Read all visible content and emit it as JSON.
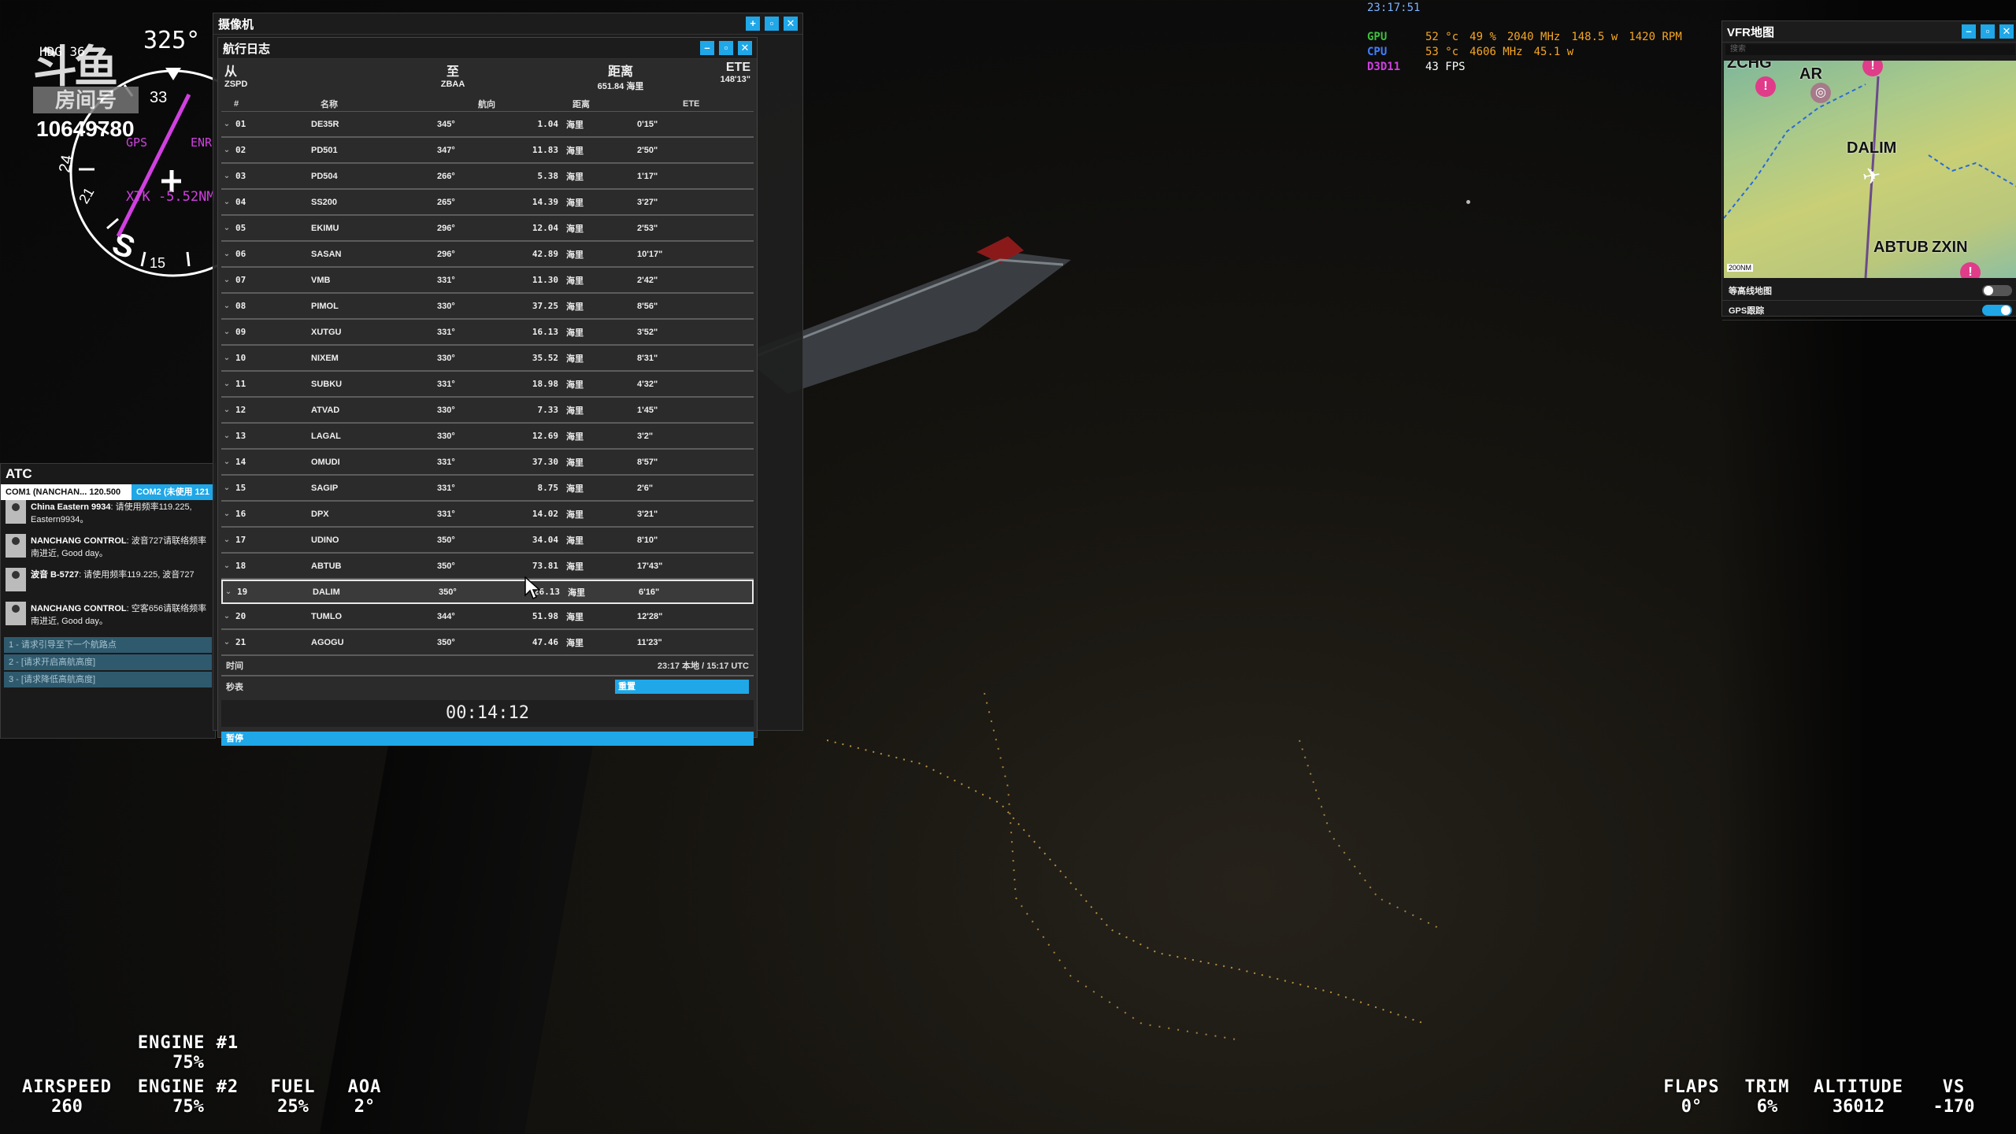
{
  "hud_top": {
    "time": "23:17:51",
    "perf": [
      {
        "key": "GPU",
        "vals": [
          "52 °c",
          "49 %",
          "2040 MHz",
          "148.5 w",
          "1420 RPM"
        ]
      },
      {
        "key": "CPU",
        "vals": [
          "53 °c",
          "4606 MHz",
          "45.1 w"
        ]
      },
      {
        "key": "D3D11",
        "vals": [
          "43 FPS"
        ]
      }
    ]
  },
  "compass": {
    "hdg_label": "HDG",
    "hdg_small": "36",
    "heading": "325°",
    "gps": "GPS",
    "enr": "ENR",
    "xtk": "XTK -5.52NM",
    "logo_main": "斗鱼",
    "logo_room": "房间号",
    "room_number": "10649780"
  },
  "camera_panel": {
    "title": "摄像机"
  },
  "logbook": {
    "title": "航行日志",
    "from_label": "从",
    "from_code": "ZSPD",
    "to_label": "至",
    "to_code": "ZBAA",
    "dist_label": "距离",
    "dist_value": "651.84 海里",
    "ete_label": "ETE",
    "ete_value": "148'13\"",
    "columns": [
      "#",
      "名称",
      "航向",
      "距离",
      "ETE"
    ],
    "rows": [
      {
        "n": "01",
        "name": "DE35R",
        "hdg": "345°",
        "dist": "1.04",
        "unit": "海里",
        "ete": "0'15\""
      },
      {
        "n": "02",
        "name": "PD501",
        "hdg": "347°",
        "dist": "11.83",
        "unit": "海里",
        "ete": "2'50\""
      },
      {
        "n": "03",
        "name": "PD504",
        "hdg": "266°",
        "dist": "5.38",
        "unit": "海里",
        "ete": "1'17\""
      },
      {
        "n": "04",
        "name": "SS200",
        "hdg": "265°",
        "dist": "14.39",
        "unit": "海里",
        "ete": "3'27\""
      },
      {
        "n": "05",
        "name": "EKIMU",
        "hdg": "296°",
        "dist": "12.04",
        "unit": "海里",
        "ete": "2'53\""
      },
      {
        "n": "06",
        "name": "SASAN",
        "hdg": "296°",
        "dist": "42.89",
        "unit": "海里",
        "ete": "10'17\""
      },
      {
        "n": "07",
        "name": "VMB",
        "hdg": "331°",
        "dist": "11.30",
        "unit": "海里",
        "ete": "2'42\""
      },
      {
        "n": "08",
        "name": "PIMOL",
        "hdg": "330°",
        "dist": "37.25",
        "unit": "海里",
        "ete": "8'56\""
      },
      {
        "n": "09",
        "name": "XUTGU",
        "hdg": "331°",
        "dist": "16.13",
        "unit": "海里",
        "ete": "3'52\""
      },
      {
        "n": "10",
        "name": "NIXEM",
        "hdg": "330°",
        "dist": "35.52",
        "unit": "海里",
        "ete": "8'31\""
      },
      {
        "n": "11",
        "name": "SUBKU",
        "hdg": "331°",
        "dist": "18.98",
        "unit": "海里",
        "ete": "4'32\""
      },
      {
        "n": "12",
        "name": "ATVAD",
        "hdg": "330°",
        "dist": "7.33",
        "unit": "海里",
        "ete": "1'45\""
      },
      {
        "n": "13",
        "name": "LAGAL",
        "hdg": "330°",
        "dist": "12.69",
        "unit": "海里",
        "ete": "3'2\""
      },
      {
        "n": "14",
        "name": "OMUDI",
        "hdg": "331°",
        "dist": "37.30",
        "unit": "海里",
        "ete": "8'57\""
      },
      {
        "n": "15",
        "name": "SAGIP",
        "hdg": "331°",
        "dist": "8.75",
        "unit": "海里",
        "ete": "2'6\""
      },
      {
        "n": "16",
        "name": "DPX",
        "hdg": "331°",
        "dist": "14.02",
        "unit": "海里",
        "ete": "3'21\""
      },
      {
        "n": "17",
        "name": "UDINO",
        "hdg": "350°",
        "dist": "34.04",
        "unit": "海里",
        "ete": "8'10\""
      },
      {
        "n": "18",
        "name": "ABTUB",
        "hdg": "350°",
        "dist": "73.81",
        "unit": "海里",
        "ete": "17'43\""
      },
      {
        "n": "19",
        "name": "DALIM",
        "hdg": "350°",
        "dist": "26.13",
        "unit": "海里",
        "ete": "6'16\""
      },
      {
        "n": "20",
        "name": "TUMLO",
        "hdg": "344°",
        "dist": "51.98",
        "unit": "海里",
        "ete": "12'28\""
      },
      {
        "n": "21",
        "name": "AGOGU",
        "hdg": "350°",
        "dist": "47.46",
        "unit": "海里",
        "ete": "11'23\""
      }
    ],
    "time_label": "时间",
    "time_value": "23:17 本地 / 15:17 UTC",
    "stopwatch_label": "秒表",
    "reset_label": "重置",
    "stopwatch_value": "00:14:12",
    "pause_label": "暂停"
  },
  "atc": {
    "title": "ATC",
    "com1": "COM1 (NANCHAN... 120.500",
    "com2": "COM2 (未使用 121",
    "messages": [
      {
        "from": "China Eastern 9934",
        "text": ": 请使用频率119.225, Eastern9934。"
      },
      {
        "from": "NANCHANG CONTROL",
        "text": ": 波音727请联络频率南进近, Good day。"
      },
      {
        "from": "波音 B-5727",
        "text": ": 请使用频率119.225, 波音727"
      },
      {
        "from": "NANCHANG CONTROL",
        "text": ": 空客656请联络频率南进近, Good day。"
      }
    ],
    "options": [
      "1 - 请求引导至下一个航路点",
      "2 - [请求开启高航高度]",
      "3 - [请求降低高航高度]"
    ]
  },
  "vfr_map": {
    "title": "VFR地图",
    "search_placeholder": "搜索",
    "labels": [
      "ZCHG",
      "AR",
      "DALIM",
      "ABTUB",
      "ZXIN"
    ],
    "scale": "200NM",
    "toggles": [
      {
        "label": "等高线地图",
        "on": false
      },
      {
        "label": "GPS跟踪",
        "on": true
      }
    ]
  },
  "bottom_hud": {
    "engine1_label": "ENGINE #1",
    "engine1_val": "75%",
    "airspeed_label": "AIRSPEED",
    "airspeed_val": "260",
    "engine2_label": "ENGINE #2",
    "engine2_val": "75%",
    "fuel_label": "FUEL",
    "fuel_val": "25%",
    "aoa_label": "AOA",
    "aoa_val": "2°",
    "flaps_label": "FLAPS",
    "flaps_val": "0°",
    "trim_label": "TRIM",
    "trim_val": "6%",
    "altitude_label": "ALTITUDE",
    "altitude_val": "36012",
    "vs_label": "VS",
    "vs_val": "-170"
  }
}
